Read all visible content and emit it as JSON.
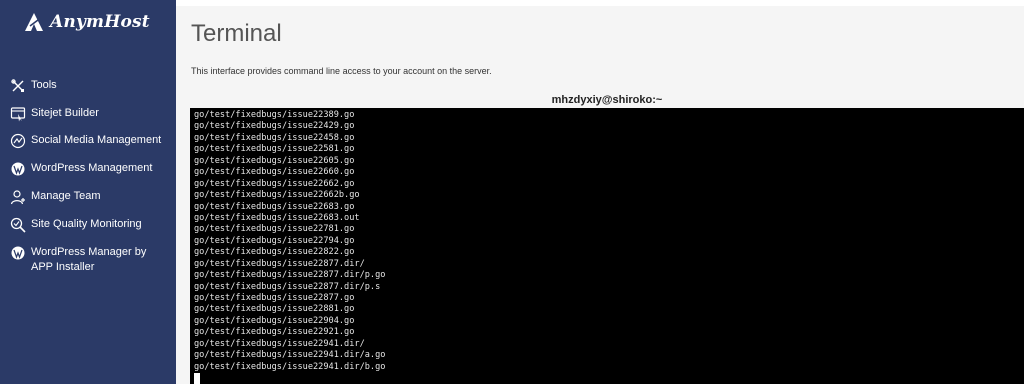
{
  "sidebar": {
    "logo_text": "AnymHost",
    "items": [
      {
        "label": "Tools",
        "icon": "tools-icon"
      },
      {
        "label": "Sitejet Builder",
        "icon": "sitejet-icon"
      },
      {
        "label": "Social Media Management",
        "icon": "social-media-icon"
      },
      {
        "label": "WordPress Management",
        "icon": "wordpress-icon"
      },
      {
        "label": "Manage Team",
        "icon": "manage-team-icon"
      },
      {
        "label": "Site Quality Monitoring",
        "icon": "site-quality-icon"
      },
      {
        "label": "WordPress Manager by APP Installer",
        "icon": "wordpress-icon"
      }
    ]
  },
  "main": {
    "title": "Terminal",
    "description": "This interface provides command line access to your account on the server.",
    "terminal_header": "mhzdyxiy@shiroko:~",
    "terminal_lines": [
      "go/test/fixedbugs/issue22389.go",
      "go/test/fixedbugs/issue22429.go",
      "go/test/fixedbugs/issue22458.go",
      "go/test/fixedbugs/issue22581.go",
      "go/test/fixedbugs/issue22605.go",
      "go/test/fixedbugs/issue22660.go",
      "go/test/fixedbugs/issue22662.go",
      "go/test/fixedbugs/issue22662b.go",
      "go/test/fixedbugs/issue22683.go",
      "go/test/fixedbugs/issue22683.out",
      "go/test/fixedbugs/issue22781.go",
      "go/test/fixedbugs/issue22794.go",
      "go/test/fixedbugs/issue22822.go",
      "go/test/fixedbugs/issue22877.dir/",
      "go/test/fixedbugs/issue22877.dir/p.go",
      "go/test/fixedbugs/issue22877.dir/p.s",
      "go/test/fixedbugs/issue22877.go",
      "go/test/fixedbugs/issue22881.go",
      "go/test/fixedbugs/issue22904.go",
      "go/test/fixedbugs/issue22921.go",
      "go/test/fixedbugs/issue22941.dir/",
      "go/test/fixedbugs/issue22941.dir/a.go",
      "go/test/fixedbugs/issue22941.dir/b.go"
    ]
  },
  "colors": {
    "sidebar_bg": "#2b3a67",
    "terminal_bg": "#000000",
    "terminal_fg": "#e6e6e6",
    "page_bg": "#f5f5f5"
  }
}
